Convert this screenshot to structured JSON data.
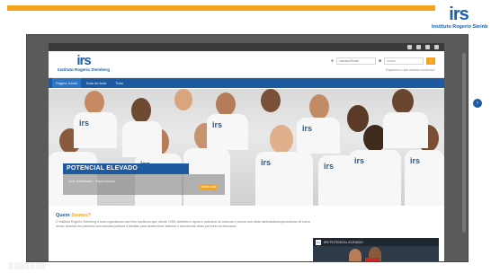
{
  "slide": {
    "watermark": "▒▒▒▒▒▒▒",
    "corner_logo": {
      "letters": "irs",
      "name": "Instituto Rogerio Steinb"
    }
  },
  "site": {
    "logo": {
      "letters": "irs",
      "name": "Instituto Rogerio Steinberg"
    },
    "login": {
      "user_placeholder": "Usuario/Email",
      "password_placeholder": "••••••••",
      "go_label": "›",
      "forgot": "Esqueceu o seu usuario ou senha?"
    },
    "nav": [
      {
        "label": "Pagina Inicial",
        "active": true
      },
      {
        "label": "Sala de Aula",
        "active": false
      },
      {
        "label": "Total",
        "active": false
      }
    ],
    "hero": {
      "banner_title": "POTENCIAL ELEVADO",
      "banner_sub": "Altas Habilidades - Superdotacao",
      "banner_button": "Saiba mais",
      "shirt_tag": "irs"
    },
    "about": {
      "title_word1": "Quem",
      "title_word2": "Somos?",
      "text": "O Instituto Rogerio Steinberg e uma organizacao sem fins lucrativos que, desde 1996, identifica e apoia o potencial de criancas e jovens com altas habilidades/superdotacao de baixa renda, atuando em parceria com escolas publicas e familias para desenvolver talentos e transformar vidas por meio da educacao."
    },
    "video": {
      "logo": "irs",
      "title": "IRS POTENCIAL ELEVADO"
    }
  },
  "colors": {
    "brand_blue": "#1e5aa0",
    "accent_orange": "#f4a31b"
  }
}
